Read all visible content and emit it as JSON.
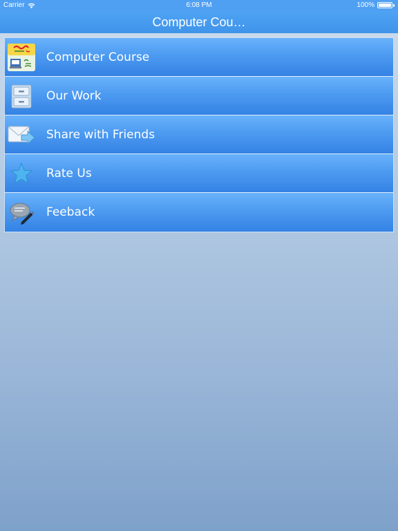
{
  "status_bar": {
    "carrier": "Carrier",
    "time": "6:08 PM",
    "battery": "100%",
    "battery_level": 1.0
  },
  "nav": {
    "title": "Computer Cou…"
  },
  "menu": {
    "items": [
      {
        "label": "Computer Course",
        "icon": "course-book-icon"
      },
      {
        "label": "Our Work",
        "icon": "cabinet-icon"
      },
      {
        "label": "Share with Friends",
        "icon": "share-envelope-icon"
      },
      {
        "label": "Rate Us",
        "icon": "star-icon"
      },
      {
        "label": "Feeback",
        "icon": "feedback-chat-icon"
      }
    ]
  },
  "colors": {
    "nav_bar": "#4fa3f4",
    "row_top": "#69b2fb",
    "row_bottom": "#3482e4",
    "background_top": "#ccdcec",
    "background_bottom": "#7ea1ca"
  }
}
